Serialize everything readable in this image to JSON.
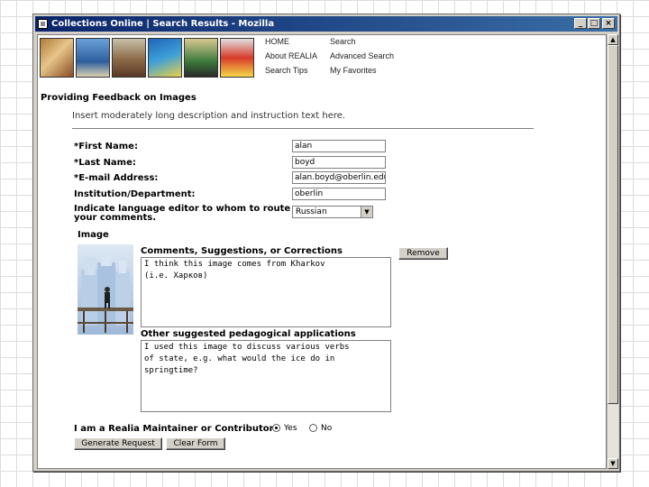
{
  "window": {
    "title": "Collections Online | Search Results - Mozilla",
    "controls": {
      "minimize": "_",
      "maximize": "□",
      "close": "×"
    }
  },
  "nav": {
    "home": "HOME",
    "search": "Search",
    "about": "About REALIA",
    "advanced_search": "Advanced Search",
    "search_tips": "Search Tips",
    "my_favorites": "My Favorites"
  },
  "page": {
    "heading": "Providing Feedback on Images",
    "intro": "Insert moderately long description and instruction text here."
  },
  "form": {
    "first_name_label": "*First Name:",
    "first_name_value": "alan",
    "last_name_label": "*Last Name:",
    "last_name_value": "boyd",
    "email_label": "*E-mail Address:",
    "email_value": "alan.boyd@oberlin.edu",
    "institution_label": "Institution/Department:",
    "institution_value": "oberlin",
    "language_label_line1": "Indicate language editor to whom to route",
    "language_label_line2": "your comments.",
    "language_value": "Russian"
  },
  "image_section": {
    "label": "Image",
    "comments_label": "Comments, Suggestions, or Corrections",
    "comments_value": "I think this image comes from Kharkov\n(i.e. Харков)",
    "remove_button": "Remove",
    "pedagogical_label": "Other suggested pedagogical applications",
    "pedagogical_value": "I used this image to discuss various verbs\nof state, e.g. what would the ice do in\nspringtime?"
  },
  "maintainer": {
    "question": "I am a Realia Maintainer or Contributor :",
    "yes_label": "Yes",
    "no_label": "No",
    "selected": "Yes"
  },
  "buttons": {
    "generate": "Generate Request",
    "clear": "Clear Form"
  },
  "icons": {
    "app": "app-icon",
    "scroll_up": "arrow-up-icon",
    "scroll_down": "arrow-down-icon",
    "dropdown": "chevron-down-icon"
  }
}
